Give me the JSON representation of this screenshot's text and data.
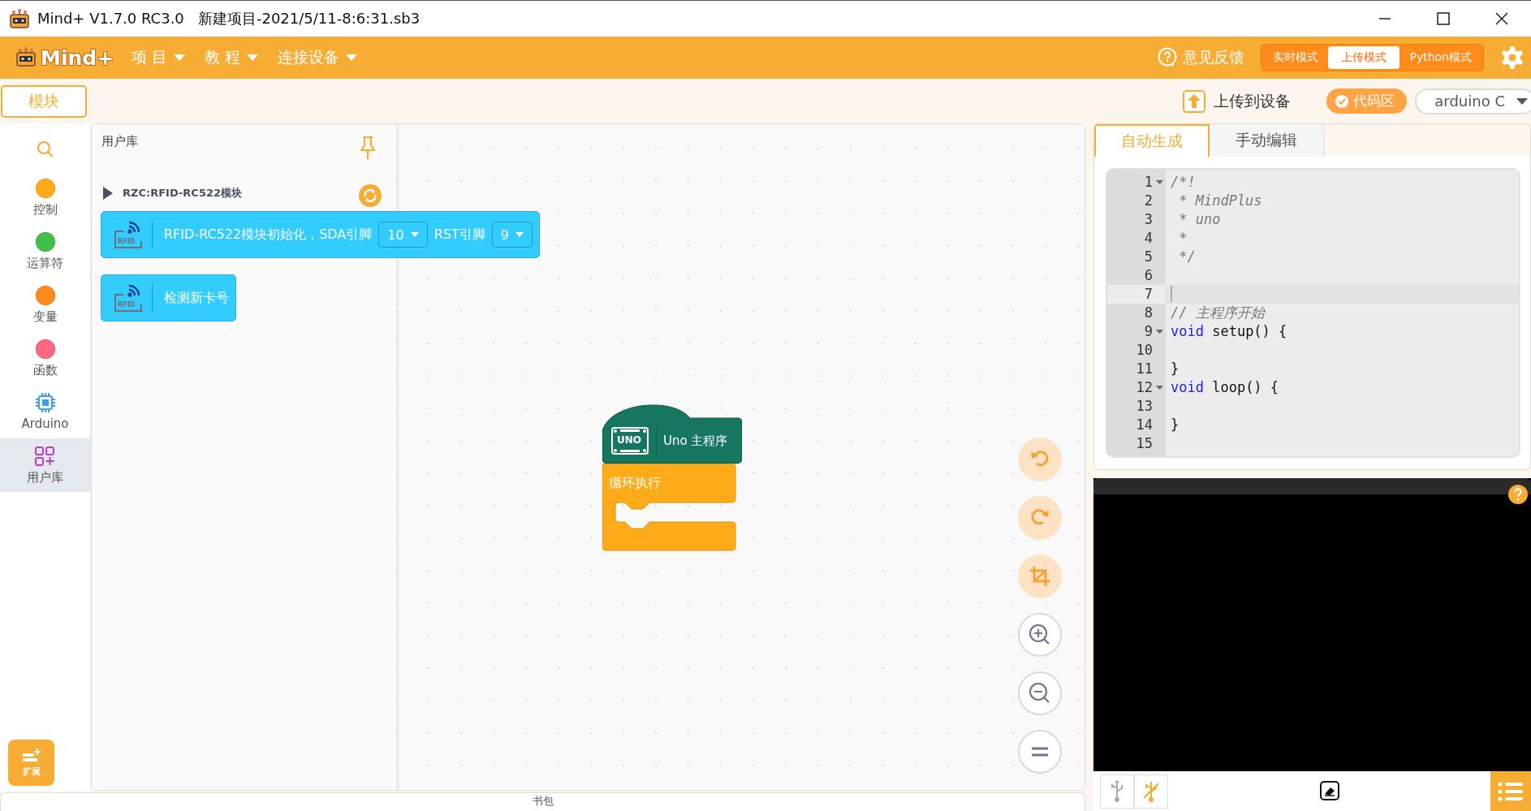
{
  "window": {
    "title": "Mind+ V1.7.0 RC3.0   新建项目-2021/5/11-8:6:31.sb3"
  },
  "menubar": {
    "logo": "Mind+",
    "menus": [
      {
        "label": "项 目"
      },
      {
        "label": "教 程"
      },
      {
        "label": "连接设备"
      }
    ],
    "feedback": "意见反馈",
    "modes": [
      {
        "label": "实时模式",
        "selected": false
      },
      {
        "label": "上传模式",
        "selected": true
      },
      {
        "label": "Python模式",
        "selected": false
      }
    ]
  },
  "subbar": {
    "tab": "模块",
    "upload": "上传到设备",
    "code_toggle": "代码区",
    "language": "arduino C"
  },
  "categories": [
    {
      "label": "控制",
      "kind": "dot",
      "color": "#ffab19",
      "selected": false
    },
    {
      "label": "运算符",
      "kind": "dot",
      "color": "#40bf4a",
      "selected": false
    },
    {
      "label": "变量",
      "kind": "dot",
      "color": "#ff8c1a",
      "selected": false
    },
    {
      "label": "函数",
      "kind": "dot",
      "color": "#ff6680",
      "selected": false
    },
    {
      "label": "Arduino",
      "kind": "chip",
      "selected": false
    },
    {
      "label": "用户库",
      "kind": "library",
      "selected": true
    }
  ],
  "extension": "扩展",
  "flyout": {
    "title": "用户库",
    "group": "RZC:RFID-RC522模块",
    "blocks": [
      {
        "badge": "RFID",
        "parts": [
          {
            "kind": "text",
            "text": "RFID-RC522模块初始化，SDA引脚"
          },
          {
            "kind": "dropdown",
            "text": "10"
          },
          {
            "kind": "text",
            "text": "RST引脚"
          },
          {
            "kind": "dropdown",
            "text": "9"
          }
        ]
      },
      {
        "badge": "RFID",
        "parts": [
          {
            "kind": "text",
            "text": "检测新卡号"
          }
        ]
      }
    ]
  },
  "canvas": {
    "hat": {
      "badge": "UNO",
      "label": "Uno 主程序"
    },
    "loop": "循环执行"
  },
  "code_tabs": [
    {
      "label": "自动生成",
      "selected": true
    },
    {
      "label": "手动编辑",
      "selected": false
    }
  ],
  "code": {
    "lines": [
      {
        "number": "1",
        "fold": true,
        "active": false,
        "tokens": [
          {
            "kind": "comment",
            "text": "/*!"
          }
        ]
      },
      {
        "number": "2",
        "fold": false,
        "active": false,
        "tokens": [
          {
            "kind": "comment",
            "text": " * MindPlus"
          }
        ]
      },
      {
        "number": "3",
        "fold": false,
        "active": false,
        "tokens": [
          {
            "kind": "comment",
            "text": " * uno"
          }
        ]
      },
      {
        "number": "4",
        "fold": false,
        "active": false,
        "tokens": [
          {
            "kind": "comment",
            "text": " *"
          }
        ]
      },
      {
        "number": "5",
        "fold": false,
        "active": false,
        "tokens": [
          {
            "kind": "comment",
            "text": " */"
          }
        ]
      },
      {
        "number": "6",
        "fold": false,
        "active": false
      },
      {
        "number": "7",
        "fold": false,
        "active": true
      },
      {
        "number": "8",
        "fold": false,
        "active": false,
        "tokens": [
          {
            "kind": "comment",
            "text": "// 主程序开始"
          }
        ]
      },
      {
        "number": "9",
        "fold": true,
        "active": false,
        "tokens": [
          {
            "kind": "keyword",
            "text": "void"
          },
          {
            "kind": "plain",
            "text": " setup() {"
          }
        ]
      },
      {
        "number": "10",
        "fold": false,
        "active": false
      },
      {
        "number": "11",
        "fold": false,
        "active": false,
        "tokens": [
          {
            "kind": "plain",
            "text": "}"
          }
        ]
      },
      {
        "number": "12",
        "fold": true,
        "active": false,
        "tokens": [
          {
            "kind": "keyword",
            "text": "void"
          },
          {
            "kind": "plain",
            "text": " loop() {"
          }
        ]
      },
      {
        "number": "13",
        "fold": false,
        "active": false
      },
      {
        "number": "14",
        "fold": false,
        "active": false,
        "tokens": [
          {
            "kind": "plain",
            "text": "}"
          }
        ]
      },
      {
        "number": "15",
        "fold": false,
        "active": false
      }
    ]
  },
  "backpack": "书包"
}
